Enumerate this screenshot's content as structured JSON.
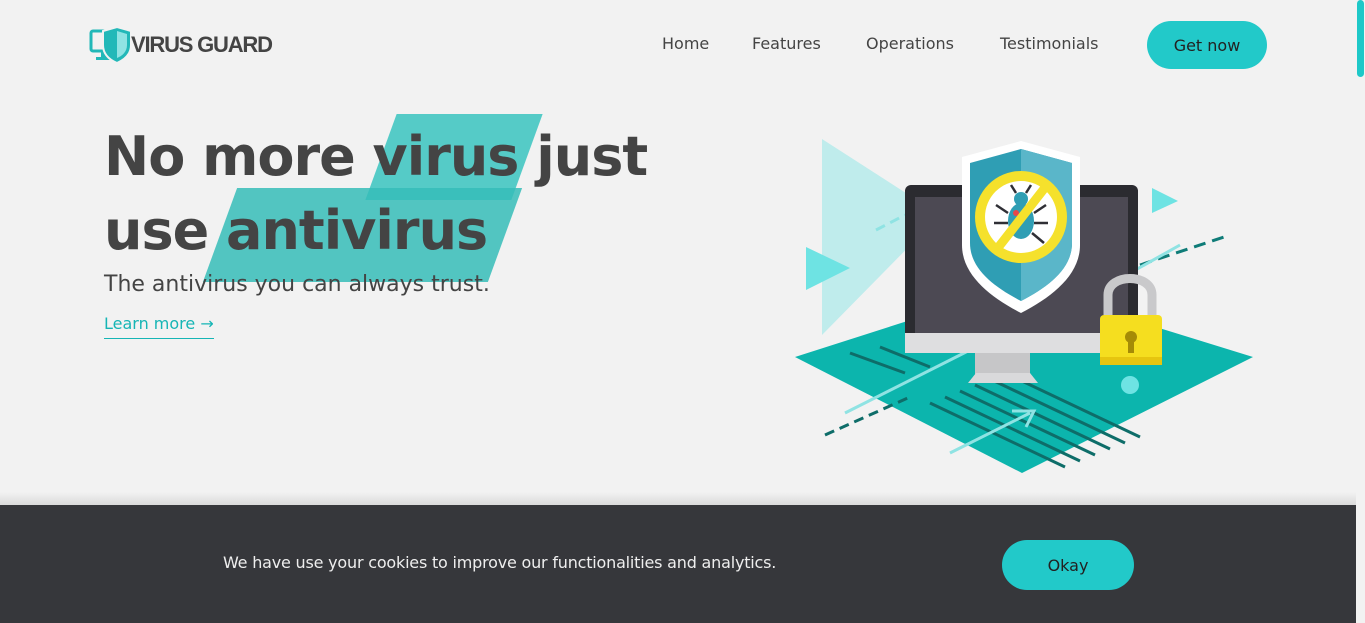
{
  "brand": {
    "name": "VIRUS GUARD",
    "logo_icon": "shield-monitor-icon",
    "accent": "#22c9c9"
  },
  "nav": {
    "items": [
      {
        "label": "Home"
      },
      {
        "label": "Features"
      },
      {
        "label": "Operations"
      },
      {
        "label": "Testimonials"
      }
    ],
    "cta_label": "Get now"
  },
  "hero": {
    "title_line1_part1": "No more ",
    "title_highlight1": "virus",
    "title_line1_part2": " just",
    "title_line2_part1": "use ",
    "title_highlight2": "antivirus",
    "subtitle": "The antivirus you can always trust.",
    "learn_more": "Learn more →",
    "illustration": "antivirus-protection-illustration"
  },
  "cookie_banner": {
    "message": "We have use your cookies to improve our functionalities and analytics.",
    "button_label": "Okay",
    "background": "#36373b"
  }
}
